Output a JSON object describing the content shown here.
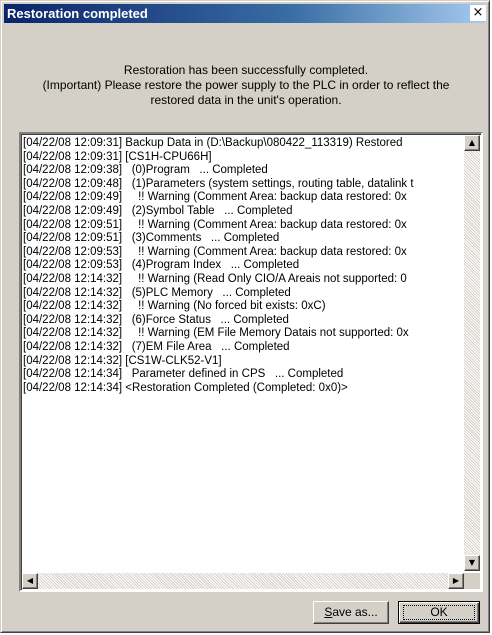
{
  "window": {
    "title": "Restoration completed",
    "close_glyph": "×"
  },
  "message": {
    "line1": "Restoration has been successfully completed.",
    "line2": "(Important) Please restore the power supply to the PLC in order to reflect the",
    "line3": "restored data in the unit's operation."
  },
  "log": {
    "lines": [
      "[04/22/08 12:09:31] Backup Data in (D:\\Backup\\080422_113319) Restored",
      "[04/22/08 12:09:31] [CS1H-CPU66H]",
      "[04/22/08 12:09:38]   (0)Program   ... Completed",
      "[04/22/08 12:09:48]   (1)Parameters (system settings, routing table, datalink t",
      "[04/22/08 12:09:49]     !! Warning (Comment Area: backup data restored: 0x",
      "[04/22/08 12:09:49]   (2)Symbol Table   ... Completed",
      "[04/22/08 12:09:51]     !! Warning (Comment Area: backup data restored: 0x",
      "[04/22/08 12:09:51]   (3)Comments   ... Completed",
      "[04/22/08 12:09:53]     !! Warning (Comment Area: backup data restored: 0x",
      "[04/22/08 12:09:53]   (4)Program Index   ... Completed",
      "[04/22/08 12:14:32]     !! Warning (Read Only CIO/A Areais not supported: 0",
      "[04/22/08 12:14:32]   (5)PLC Memory   ... Completed",
      "[04/22/08 12:14:32]     !! Warning (No forced bit exists: 0xC)",
      "[04/22/08 12:14:32]   (6)Force Status   ... Completed",
      "[04/22/08 12:14:32]     !! Warning (EM File Memory Datais not supported: 0x",
      "[04/22/08 12:14:32]   (7)EM File Area   ... Completed",
      "[04/22/08 12:14:32] [CS1W-CLK52-V1]",
      "[04/22/08 12:14:34]   Parameter defined in CPS   ... Completed",
      "[04/22/08 12:14:34] <Restoration Completed (Completed: 0x0)>"
    ]
  },
  "buttons": {
    "save_prefix": "S",
    "save_rest": "ave as...",
    "ok": "OK"
  },
  "scroll": {
    "up": "▲",
    "down": "▼",
    "left": "◀",
    "right": "▶"
  }
}
